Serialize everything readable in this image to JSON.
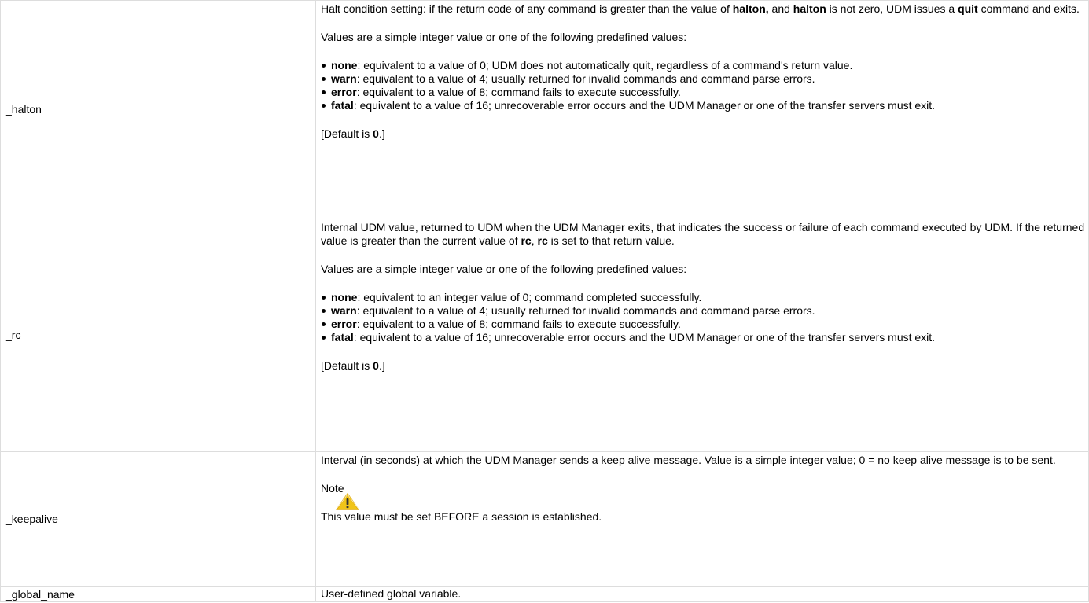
{
  "rows": [
    {
      "name": "_halton",
      "desc": {
        "p1_a": "Halt condition setting: if the return code of any command is greater than the value of ",
        "p1_b1": "halton,",
        "p1_c": " and ",
        "p1_b2": "halton",
        "p1_d": " is not zero, UDM issues a ",
        "p1_b3": "quit",
        "p1_e": " command and exits.",
        "p2": "Values are a simple integer value or one of the following predefined values:",
        "items": [
          {
            "term": "none",
            "text": ": equivalent to a value of 0; UDM does not automatically quit, regardless of a command's return value."
          },
          {
            "term": "warn",
            "text": ": equivalent to a value of 4; usually returned for invalid commands and command parse errors."
          },
          {
            "term": "error",
            "text": ": equivalent to a value of 8; command fails to execute successfully."
          },
          {
            "term": "fatal",
            "text": ": equivalent to a value of 16; unrecoverable error occurs and the UDM Manager or one of the transfer servers must exit."
          }
        ],
        "default_prefix": "[Default is ",
        "default_value": "0",
        "default_suffix": ".]"
      }
    },
    {
      "name": "_rc",
      "desc": {
        "p1_a": "Internal UDM value, returned to UDM when the UDM Manager exits, that indicates the success or failure of each command executed by UDM. If the returned value is greater than the current value of ",
        "p1_b1": "rc",
        "p1_c": ", ",
        "p1_b2": "rc",
        "p1_d": " is set to that return value.",
        "p2": "Values are a simple integer value or one of the following predefined values:",
        "items": [
          {
            "term": "none",
            "text": ": equivalent to an integer value of 0; command completed successfully."
          },
          {
            "term": "warn",
            "text": ": equivalent to a value of 4; usually returned for invalid commands and command parse errors."
          },
          {
            "term": "error",
            "text": ": equivalent to a value of 8; command fails to execute successfully."
          },
          {
            "term": "fatal",
            "text": ": equivalent to a value of 16; unrecoverable error occurs and the UDM Manager or one of the transfer servers must exit."
          }
        ],
        "default_prefix": "[Default is ",
        "default_value": "0",
        "default_suffix": ".]"
      }
    },
    {
      "name": "_keepalive",
      "desc": {
        "p1": "Interval (in seconds) at which the UDM Manager sends a keep alive message. Value is a simple integer value; 0 = no keep alive message is to be sent.",
        "note_label": "Note",
        "note_icon": "warning-icon",
        "note_text": "This value must be set BEFORE a session is established."
      }
    },
    {
      "name": "_global_name",
      "desc": {
        "p1": "User-defined global variable."
      }
    }
  ],
  "colors": {
    "border": "#dddddd",
    "warning_fill": "#f0c419",
    "warning_stroke": "#e0a800"
  }
}
